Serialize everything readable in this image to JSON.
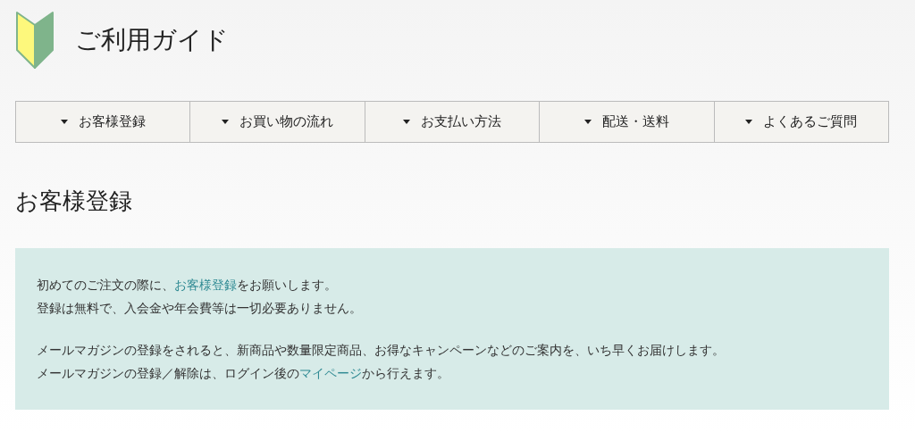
{
  "header": {
    "title": "ご利用ガイド"
  },
  "nav": [
    {
      "label": "お客様登録"
    },
    {
      "label": "お買い物の流れ"
    },
    {
      "label": "お支払い方法"
    },
    {
      "label": "配送・送料"
    },
    {
      "label": "よくあるご質問"
    }
  ],
  "section": {
    "heading": "お客様登録",
    "paragraphs": [
      [
        [
          {
            "kind": "text",
            "text": "初めてのご注文の際に、"
          },
          {
            "kind": "link",
            "text": "お客様登録"
          },
          {
            "kind": "text",
            "text": "をお願いします。"
          }
        ],
        [
          {
            "kind": "text",
            "text": "登録は無料で、入会金や年会費等は一切必要ありません。"
          }
        ]
      ],
      [
        [
          {
            "kind": "text",
            "text": "メールマガジンの登録をされると、新商品や数量限定商品、お得なキャンペーンなどのご案内を、いち早くお届けします。"
          }
        ],
        [
          {
            "kind": "text",
            "text": "メールマガジンの登録／解除は、ログイン後の"
          },
          {
            "kind": "link",
            "text": "マイページ"
          },
          {
            "kind": "text",
            "text": "から行えます。"
          }
        ]
      ]
    ]
  }
}
